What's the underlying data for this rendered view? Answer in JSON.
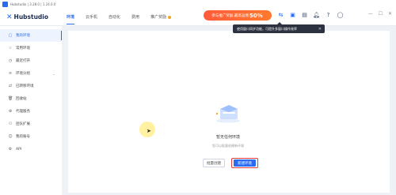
{
  "window": {
    "title": "Hubstudio | 3.28.0 | 1.24.0.0"
  },
  "logo": {
    "mark": "✕",
    "text": "Hubstudio"
  },
  "nav": {
    "tabs": [
      {
        "label": "环境"
      },
      {
        "label": "云手机"
      },
      {
        "label": "自动化"
      },
      {
        "label": "费用"
      },
      {
        "label": "推广奖励"
      }
    ]
  },
  "promo": {
    "prefix": "参与推广奖励,最高返佣",
    "highlight": "50%",
    "suffix": ""
  },
  "tooltip": {
    "text": "使用窗口同步功能，可提升多窗口操作效率",
    "close": "✕"
  },
  "window_controls": {
    "minimize": "—",
    "maximize": "☐",
    "close": "✕"
  },
  "sidebar": {
    "items": [
      {
        "label": "我的环境",
        "icon": "window-icon"
      },
      {
        "label": "常用环境",
        "icon": "star-icon"
      },
      {
        "label": "最近打开",
        "icon": "clock-icon"
      },
      {
        "label": "环境分组",
        "icon": "layers-icon",
        "arrow": "⌄"
      },
      {
        "label": "已转移环境",
        "icon": "transfer-icon"
      },
      {
        "label": "回收站",
        "icon": "trash-icon"
      },
      {
        "label": "代理服务",
        "icon": "proxy-icon"
      },
      {
        "label": "团队扩展",
        "icon": "team-icon"
      },
      {
        "label": "我的账号",
        "icon": "user-icon"
      },
      {
        "label": "API",
        "icon": "api-icon"
      }
    ]
  },
  "empty_state": {
    "title": "暂无任何环境",
    "subtitle": "您可以批量创建新环境",
    "batch_button": "批量创建",
    "new_button": "新建环境"
  },
  "colors": {
    "accent": "#2a6bf2",
    "promo": "#ff5b3b",
    "highlight_border": "#e23a3a"
  }
}
